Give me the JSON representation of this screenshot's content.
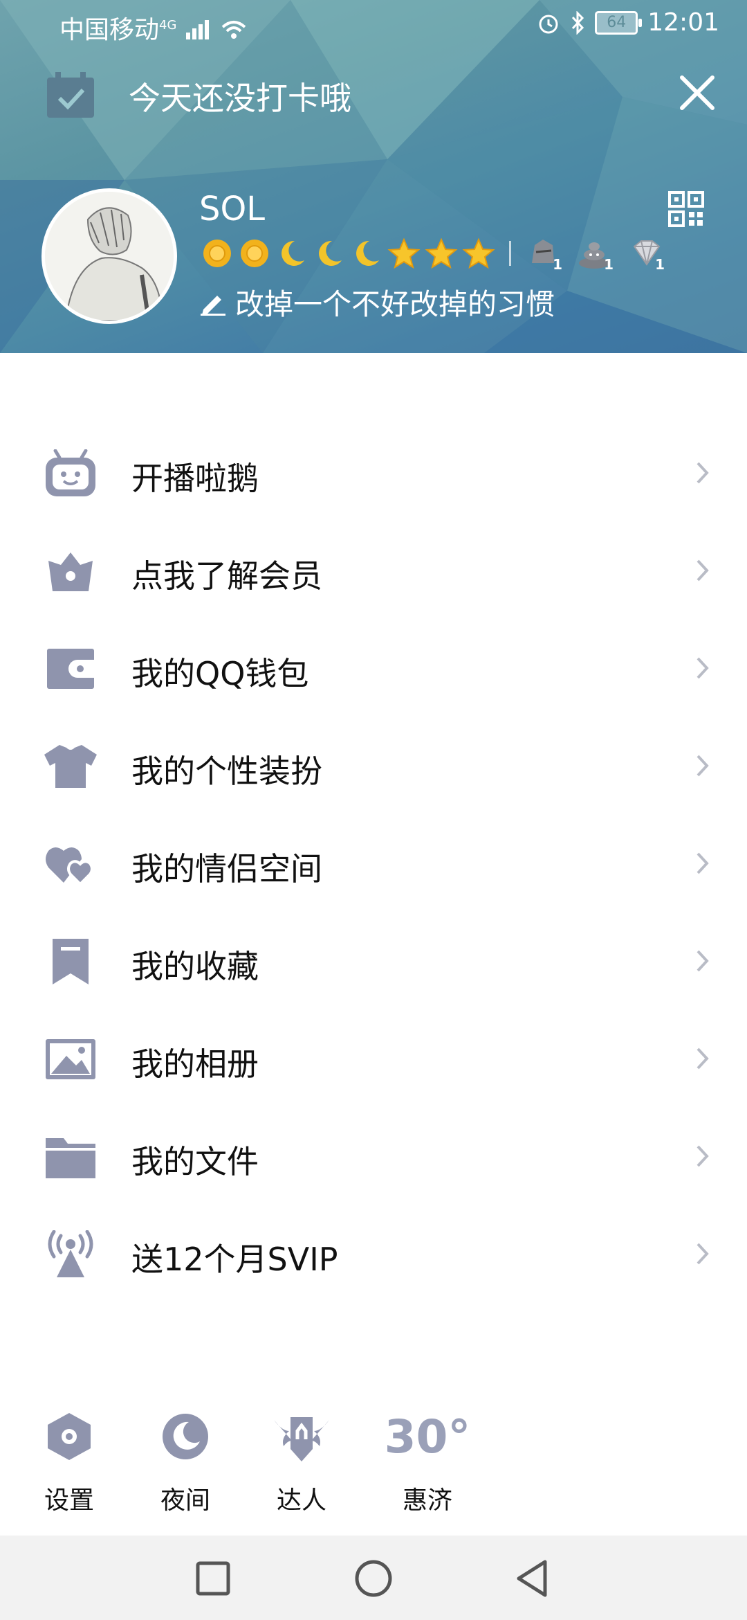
{
  "status_bar": {
    "carrier": "中国移动",
    "network": "4G",
    "battery": "64",
    "time": "12:01"
  },
  "checkin": {
    "text": "今天还没打卡哦"
  },
  "profile": {
    "name": "SOL",
    "signature": "改掉一个不好改掉的习惯",
    "level_icons": [
      "sun",
      "sun",
      "moon",
      "moon",
      "moon",
      "star",
      "star",
      "star"
    ],
    "badges": [
      {
        "icon": "knight-badge-icon",
        "count": "1"
      },
      {
        "icon": "poop-badge-icon",
        "count": "1"
      },
      {
        "icon": "diamond-badge-icon",
        "count": "1"
      }
    ]
  },
  "menu": {
    "items": [
      {
        "label": "开播啦鹅",
        "icon": "tv-robot-icon"
      },
      {
        "label": "点我了解会员",
        "icon": "crown-icon"
      },
      {
        "label": "我的QQ钱包",
        "icon": "wallet-icon"
      },
      {
        "label": "我的个性装扮",
        "icon": "tshirt-icon"
      },
      {
        "label": "我的情侣空间",
        "icon": "hearts-icon"
      },
      {
        "label": "我的收藏",
        "icon": "bookmark-icon"
      },
      {
        "label": "我的相册",
        "icon": "photo-icon"
      },
      {
        "label": "我的文件",
        "icon": "folder-icon"
      },
      {
        "label": "送12个月SVIP",
        "icon": "broadcast-icon"
      }
    ]
  },
  "shortcuts": {
    "settings": "设置",
    "night": "夜间",
    "expert": "达人",
    "temperature": "30°",
    "city": "惠济"
  },
  "colors": {
    "icon_gray": "#8f94ad",
    "chevron": "#b9bcc6",
    "header_teal": "#5c95a3"
  }
}
